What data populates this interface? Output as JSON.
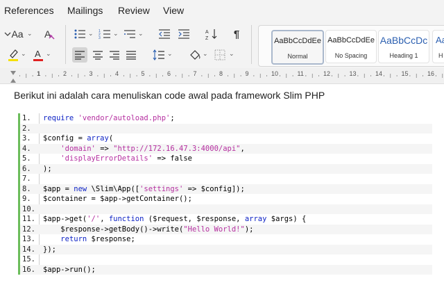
{
  "menu": {
    "references": "References",
    "mailings": "Mailings",
    "review": "Review",
    "view": "View"
  },
  "ribbon": {
    "font_size_aa": "Aa",
    "styles": [
      {
        "sample": "AaBbCcDdEe",
        "name": "Normal",
        "selected": true
      },
      {
        "sample": "AaBbCcDdEe",
        "name": "No Spacing",
        "selected": false
      },
      {
        "sample": "AaBbCcDc",
        "name": "Heading 1",
        "selected": false
      },
      {
        "sample": "AaBb",
        "name": "H",
        "selected": false
      }
    ]
  },
  "ruler": {
    "numbers": [
      "1",
      "1",
      "2",
      "3",
      "4",
      "5",
      "6",
      "7",
      "8",
      "9",
      "10",
      "11",
      "12",
      "13",
      "14",
      "15",
      "16"
    ]
  },
  "document": {
    "heading": "Berikut ini adalah cara menuliskan code awal pada framework Slim PHP",
    "code_lines": [
      {
        "n": "1.",
        "src": "require 'vendor/autoload.php';"
      },
      {
        "n": "2.",
        "src": ""
      },
      {
        "n": "3.",
        "src": "$config = array("
      },
      {
        "n": "4.",
        "src": "    'domain' => \"http://172.16.47.3:4000/api\","
      },
      {
        "n": "5.",
        "src": "    'displayErrorDetails' => false"
      },
      {
        "n": "6.",
        "src": ");"
      },
      {
        "n": "7.",
        "src": ""
      },
      {
        "n": "8.",
        "src": "$app = new \\Slim\\App(['settings' => $config]);"
      },
      {
        "n": "9.",
        "src": "$container = $app->getContainer();"
      },
      {
        "n": "10.",
        "src": ""
      },
      {
        "n": "11.",
        "src": "$app->get('/', function ($request, $response, array $args) {"
      },
      {
        "n": "12.",
        "src": "    $response->getBody()->write(\"Hello World!\");"
      },
      {
        "n": "13.",
        "src": "    return $response;"
      },
      {
        "n": "14.",
        "src": "});"
      },
      {
        "n": "15.",
        "src": ""
      },
      {
        "n": "16.",
        "src": "$app->run();"
      }
    ]
  },
  "colors": {
    "keyword": "#0a1fc4",
    "string": "#b52fa0",
    "gutter": "#6bbd5b",
    "highlight_yellow": "#f5e000",
    "font_red": "#e02020"
  }
}
